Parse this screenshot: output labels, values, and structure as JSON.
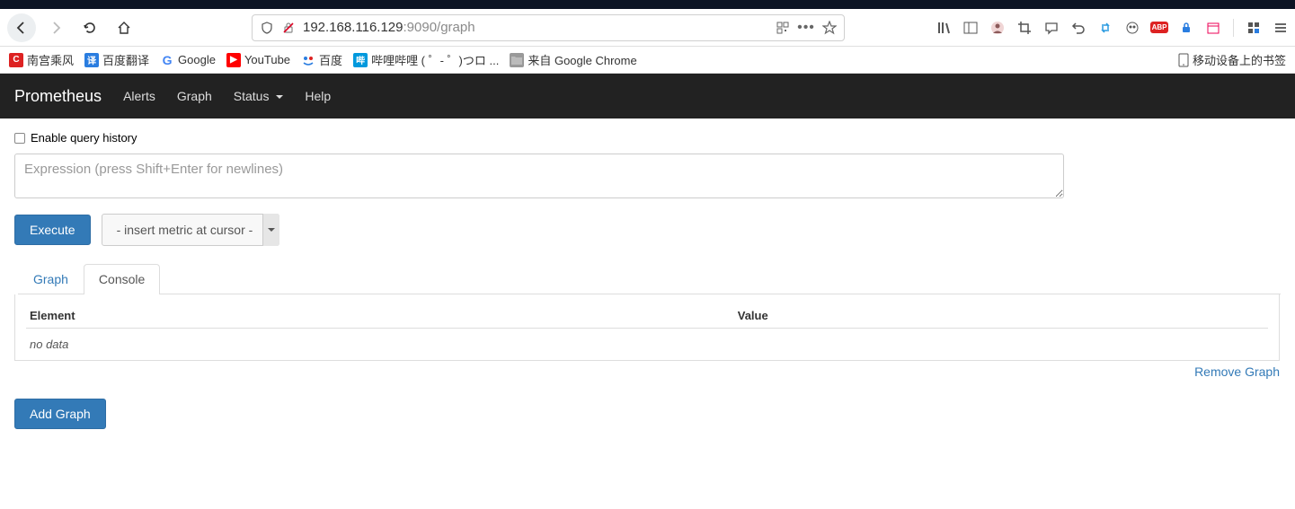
{
  "browser": {
    "url_prefix": "192.168.116.129",
    "url_suffix": ":9090/graph"
  },
  "bookmarks": {
    "items": [
      {
        "label": "南宫乘风"
      },
      {
        "label": "百度翻译"
      },
      {
        "label": "Google"
      },
      {
        "label": "YouTube"
      },
      {
        "label": "百度"
      },
      {
        "label": "哔哩哔哩 ( ゜- ゜)つロ ..."
      },
      {
        "label": "来自 Google Chrome"
      }
    ],
    "mobile": "移动设备上的书签"
  },
  "navbar": {
    "brand": "Prometheus",
    "alerts": "Alerts",
    "graph": "Graph",
    "status": "Status",
    "help": "Help"
  },
  "page": {
    "history_label": "Enable query history",
    "expr_placeholder": "Expression (press Shift+Enter for newlines)",
    "execute": "Execute",
    "metric_placeholder": "- insert metric at cursor -",
    "tab_graph": "Graph",
    "tab_console": "Console",
    "col_element": "Element",
    "col_value": "Value",
    "no_data": "no data",
    "remove_graph": "Remove Graph",
    "add_graph": "Add Graph"
  }
}
